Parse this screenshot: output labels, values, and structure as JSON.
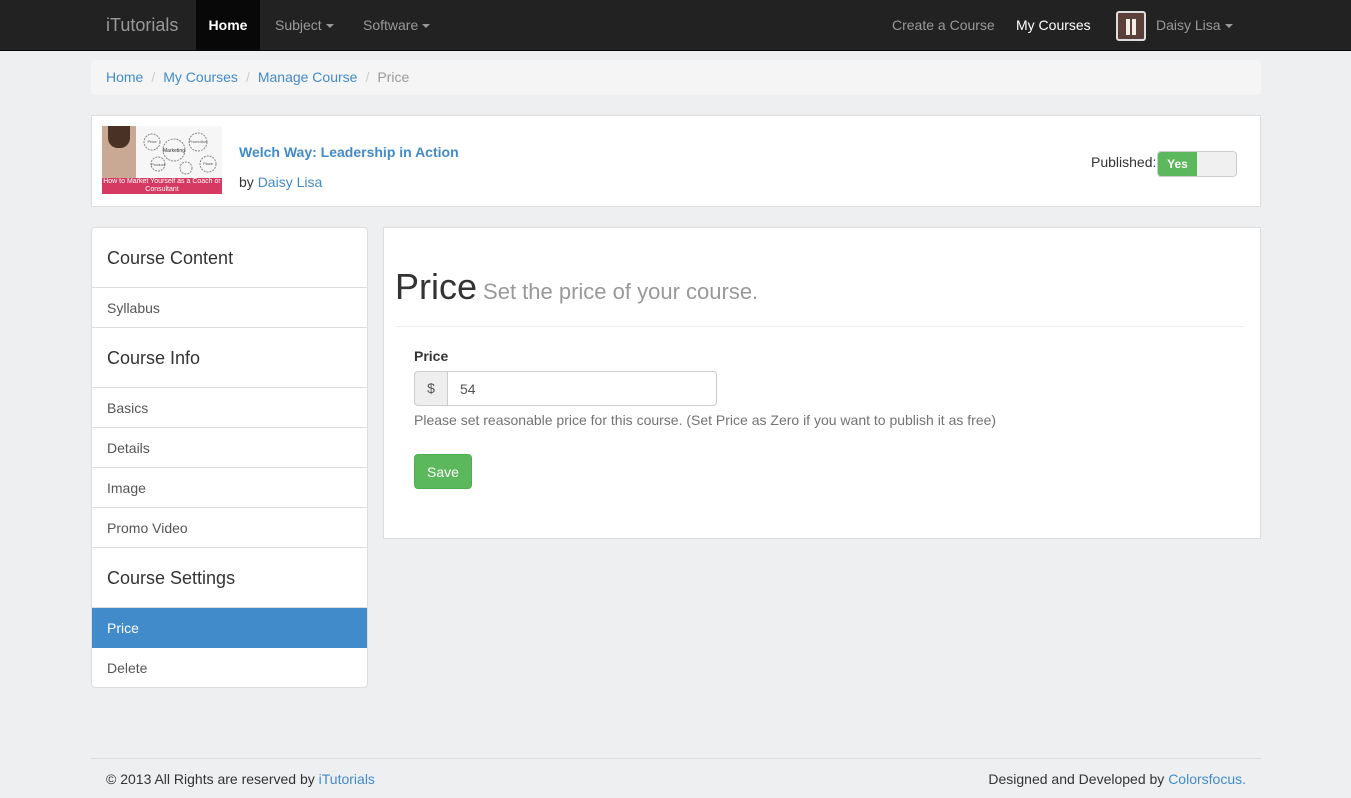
{
  "navbar": {
    "brand": "iTutorials",
    "home": "Home",
    "subject": "Subject",
    "software": "Software",
    "create_course": "Create a Course",
    "my_courses": "My Courses",
    "user": "Daisy Lisa"
  },
  "breadcrumb": {
    "home": "Home",
    "my_courses": "My Courses",
    "manage_course": "Manage Course",
    "current": "Price",
    "separator": "/"
  },
  "course": {
    "thumb_caption": "How to Market Yourself as a Coach or Consultant",
    "thumb_words": [
      "Marketing",
      "Product",
      "Promotion",
      "Price",
      "Place"
    ],
    "title": "Welch Way: Leadership in Action",
    "by_prefix": "by",
    "author": "Daisy Lisa",
    "published_label": "Published:",
    "published_value": "Yes"
  },
  "sidebar": {
    "sections": [
      {
        "heading": "Course Content",
        "items": [
          "Syllabus"
        ]
      },
      {
        "heading": "Course Info",
        "items": [
          "Basics",
          "Details",
          "Image",
          "Promo Video"
        ]
      },
      {
        "heading": "Course Settings",
        "items": [
          "Price",
          "Delete"
        ]
      }
    ],
    "active_item": "Price"
  },
  "main": {
    "title": "Price",
    "subtitle": "Set the price of your course.",
    "price_label": "Price",
    "currency": "$",
    "price_value": "54",
    "help_text": "Please set reasonable price for this course. (Set Price as Zero if you want to publish it as free)",
    "save_label": "Save"
  },
  "footer": {
    "copyright": "© 2013 All Rights are reserved by",
    "copyright_link": "iTutorials",
    "credit": "Designed and Developed by",
    "credit_link": "Colorsfocus",
    "credit_suffix": "."
  },
  "colors": {
    "navbar_bg": "#222222",
    "link": "#428bca",
    "active_item_bg": "#428bca",
    "success": "#5cb85c",
    "thumb_band": "#d63a62"
  }
}
